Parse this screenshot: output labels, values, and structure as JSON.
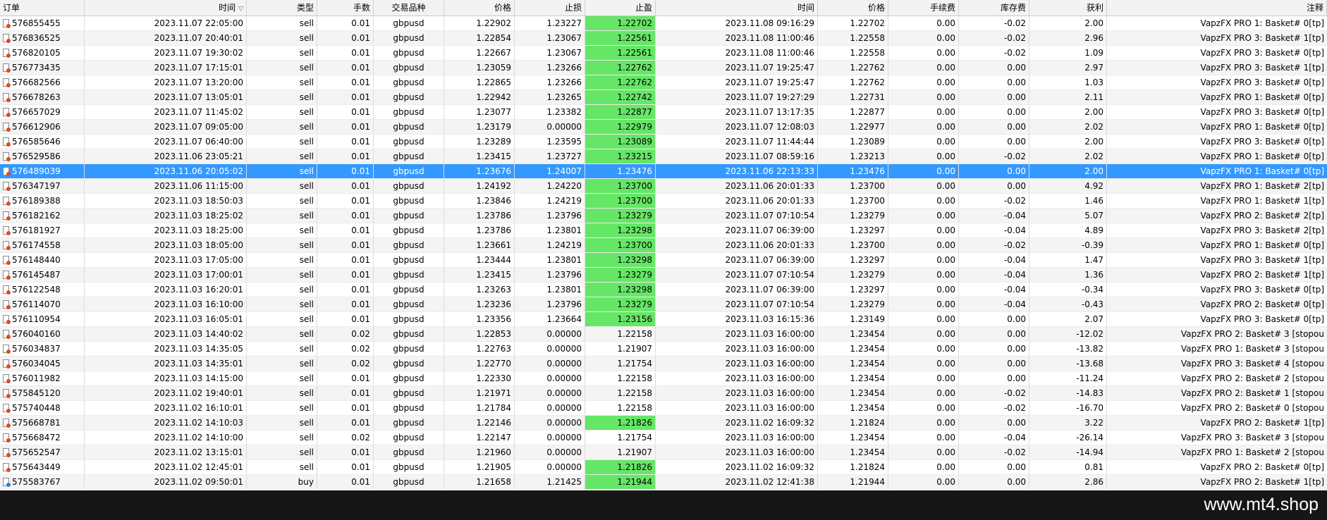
{
  "header": {
    "order": "订单",
    "time": "时间",
    "sort_indicator": "▽",
    "type": "类型",
    "lots": "手数",
    "symbol": "交易品种",
    "price": "价格",
    "sl": "止损",
    "tp": "止盈",
    "close_time": "时间",
    "close_price": "价格",
    "commission": "手续费",
    "swap": "库存费",
    "profit": "获利",
    "comment": "注释"
  },
  "rows": [
    [
      "576855455",
      "2023.11.07 22:05:00",
      "sell",
      "0.01",
      "gbpusd",
      "1.22902",
      "1.23227",
      "1.22702",
      "2023.11.08 09:16:29",
      "1.22702",
      "0.00",
      "-0.02",
      "2.00",
      "VapzFX PRO 1: Basket# 0[tp]"
    ],
    [
      "576836525",
      "2023.11.07 20:40:01",
      "sell",
      "0.01",
      "gbpusd",
      "1.22854",
      "1.23067",
      "1.22561",
      "2023.11.08 11:00:46",
      "1.22558",
      "0.00",
      "-0.02",
      "2.96",
      "VapzFX PRO 3: Basket# 1[tp]"
    ],
    [
      "576820105",
      "2023.11.07 19:30:02",
      "sell",
      "0.01",
      "gbpusd",
      "1.22667",
      "1.23067",
      "1.22561",
      "2023.11.08 11:00:46",
      "1.22558",
      "0.00",
      "-0.02",
      "1.09",
      "VapzFX PRO 3: Basket# 0[tp]"
    ],
    [
      "576773435",
      "2023.11.07 17:15:01",
      "sell",
      "0.01",
      "gbpusd",
      "1.23059",
      "1.23266",
      "1.22762",
      "2023.11.07 19:25:47",
      "1.22762",
      "0.00",
      "0.00",
      "2.97",
      "VapzFX PRO 3: Basket# 1[tp]"
    ],
    [
      "576682566",
      "2023.11.07 13:20:00",
      "sell",
      "0.01",
      "gbpusd",
      "1.22865",
      "1.23266",
      "1.22762",
      "2023.11.07 19:25:47",
      "1.22762",
      "0.00",
      "0.00",
      "1.03",
      "VapzFX PRO 3: Basket# 0[tp]"
    ],
    [
      "576678263",
      "2023.11.07 13:05:01",
      "sell",
      "0.01",
      "gbpusd",
      "1.22942",
      "1.23265",
      "1.22742",
      "2023.11.07 19:27:29",
      "1.22731",
      "0.00",
      "0.00",
      "2.11",
      "VapzFX PRO 1: Basket# 0[tp]"
    ],
    [
      "576657029",
      "2023.11.07 11:45:02",
      "sell",
      "0.01",
      "gbpusd",
      "1.23077",
      "1.23382",
      "1.22877",
      "2023.11.07 13:17:35",
      "1.22877",
      "0.00",
      "0.00",
      "2.00",
      "VapzFX PRO 3: Basket# 0[tp]"
    ],
    [
      "576612906",
      "2023.11.07 09:05:00",
      "sell",
      "0.01",
      "gbpusd",
      "1.23179",
      "0.00000",
      "1.22979",
      "2023.11.07 12:08:03",
      "1.22977",
      "0.00",
      "0.00",
      "2.02",
      "VapzFX PRO 1: Basket# 0[tp]"
    ],
    [
      "576585646",
      "2023.11.07 06:40:00",
      "sell",
      "0.01",
      "gbpusd",
      "1.23289",
      "1.23595",
      "1.23089",
      "2023.11.07 11:44:44",
      "1.23089",
      "0.00",
      "0.00",
      "2.00",
      "VapzFX PRO 3: Basket# 0[tp]"
    ],
    [
      "576529586",
      "2023.11.06 23:05:21",
      "sell",
      "0.01",
      "gbpusd",
      "1.23415",
      "1.23727",
      "1.23215",
      "2023.11.07 08:59:16",
      "1.23213",
      "0.00",
      "-0.02",
      "2.02",
      "VapzFX PRO 1: Basket# 0[tp]"
    ],
    [
      "576489039",
      "2023.11.06 20:05:02",
      "sell",
      "0.01",
      "gbpusd",
      "1.23676",
      "1.24007",
      "1.23476",
      "2023.11.06 22:13:33",
      "1.23476",
      "0.00",
      "0.00",
      "2.00",
      "VapzFX PRO 1: Basket# 0[tp]"
    ],
    [
      "576347197",
      "2023.11.06 11:15:00",
      "sell",
      "0.01",
      "gbpusd",
      "1.24192",
      "1.24220",
      "1.23700",
      "2023.11.06 20:01:33",
      "1.23700",
      "0.00",
      "0.00",
      "4.92",
      "VapzFX PRO 1: Basket# 2[tp]"
    ],
    [
      "576189388",
      "2023.11.03 18:50:03",
      "sell",
      "0.01",
      "gbpusd",
      "1.23846",
      "1.24219",
      "1.23700",
      "2023.11.06 20:01:33",
      "1.23700",
      "0.00",
      "-0.02",
      "1.46",
      "VapzFX PRO 1: Basket# 1[tp]"
    ],
    [
      "576182162",
      "2023.11.03 18:25:02",
      "sell",
      "0.01",
      "gbpusd",
      "1.23786",
      "1.23796",
      "1.23279",
      "2023.11.07 07:10:54",
      "1.23279",
      "0.00",
      "-0.04",
      "5.07",
      "VapzFX PRO 2: Basket# 2[tp]"
    ],
    [
      "576181927",
      "2023.11.03 18:25:00",
      "sell",
      "0.01",
      "gbpusd",
      "1.23786",
      "1.23801",
      "1.23298",
      "2023.11.07 06:39:00",
      "1.23297",
      "0.00",
      "-0.04",
      "4.89",
      "VapzFX PRO 3: Basket# 2[tp]"
    ],
    [
      "576174558",
      "2023.11.03 18:05:00",
      "sell",
      "0.01",
      "gbpusd",
      "1.23661",
      "1.24219",
      "1.23700",
      "2023.11.06 20:01:33",
      "1.23700",
      "0.00",
      "-0.02",
      "-0.39",
      "VapzFX PRO 1: Basket# 0[tp]"
    ],
    [
      "576148440",
      "2023.11.03 17:05:00",
      "sell",
      "0.01",
      "gbpusd",
      "1.23444",
      "1.23801",
      "1.23298",
      "2023.11.07 06:39:00",
      "1.23297",
      "0.00",
      "-0.04",
      "1.47",
      "VapzFX PRO 3: Basket# 1[tp]"
    ],
    [
      "576145487",
      "2023.11.03 17:00:01",
      "sell",
      "0.01",
      "gbpusd",
      "1.23415",
      "1.23796",
      "1.23279",
      "2023.11.07 07:10:54",
      "1.23279",
      "0.00",
      "-0.04",
      "1.36",
      "VapzFX PRO 2: Basket# 1[tp]"
    ],
    [
      "576122548",
      "2023.11.03 16:20:01",
      "sell",
      "0.01",
      "gbpusd",
      "1.23263",
      "1.23801",
      "1.23298",
      "2023.11.07 06:39:00",
      "1.23297",
      "0.00",
      "-0.04",
      "-0.34",
      "VapzFX PRO 3: Basket# 0[tp]"
    ],
    [
      "576114070",
      "2023.11.03 16:10:00",
      "sell",
      "0.01",
      "gbpusd",
      "1.23236",
      "1.23796",
      "1.23279",
      "2023.11.07 07:10:54",
      "1.23279",
      "0.00",
      "-0.04",
      "-0.43",
      "VapzFX PRO 2: Basket# 0[tp]"
    ],
    [
      "576110954",
      "2023.11.03 16:05:01",
      "sell",
      "0.01",
      "gbpusd",
      "1.23356",
      "1.23664",
      "1.23156",
      "2023.11.03 16:15:36",
      "1.23149",
      "0.00",
      "0.00",
      "2.07",
      "VapzFX PRO 3: Basket# 0[tp]"
    ],
    [
      "576040160",
      "2023.11.03 14:40:02",
      "sell",
      "0.02",
      "gbpusd",
      "1.22853",
      "0.00000",
      "1.22158",
      "2023.11.03 16:00:00",
      "1.23454",
      "0.00",
      "0.00",
      "-12.02",
      "VapzFX PRO 2: Basket# 3 [stopou"
    ],
    [
      "576034837",
      "2023.11.03 14:35:05",
      "sell",
      "0.02",
      "gbpusd",
      "1.22763",
      "0.00000",
      "1.21907",
      "2023.11.03 16:00:00",
      "1.23454",
      "0.00",
      "0.00",
      "-13.82",
      "VapzFX PRO 1: Basket# 3 [stopou"
    ],
    [
      "576034045",
      "2023.11.03 14:35:01",
      "sell",
      "0.02",
      "gbpusd",
      "1.22770",
      "0.00000",
      "1.21754",
      "2023.11.03 16:00:00",
      "1.23454",
      "0.00",
      "0.00",
      "-13.68",
      "VapzFX PRO 3: Basket# 4 [stopou"
    ],
    [
      "576011982",
      "2023.11.03 14:15:00",
      "sell",
      "0.01",
      "gbpusd",
      "1.22330",
      "0.00000",
      "1.22158",
      "2023.11.03 16:00:00",
      "1.23454",
      "0.00",
      "0.00",
      "-11.24",
      "VapzFX PRO 2: Basket# 2 [stopou"
    ],
    [
      "575845120",
      "2023.11.02 19:40:01",
      "sell",
      "0.01",
      "gbpusd",
      "1.21971",
      "0.00000",
      "1.22158",
      "2023.11.03 16:00:00",
      "1.23454",
      "0.00",
      "-0.02",
      "-14.83",
      "VapzFX PRO 2: Basket# 1 [stopou"
    ],
    [
      "575740448",
      "2023.11.02 16:10:01",
      "sell",
      "0.01",
      "gbpusd",
      "1.21784",
      "0.00000",
      "1.22158",
      "2023.11.03 16:00:00",
      "1.23454",
      "0.00",
      "-0.02",
      "-16.70",
      "VapzFX PRO 2: Basket# 0 [stopou"
    ],
    [
      "575668781",
      "2023.11.02 14:10:03",
      "sell",
      "0.01",
      "gbpusd",
      "1.22146",
      "0.00000",
      "1.21826",
      "2023.11.02 16:09:32",
      "1.21824",
      "0.00",
      "0.00",
      "3.22",
      "VapzFX PRO 2: Basket# 1[tp]"
    ],
    [
      "575668472",
      "2023.11.02 14:10:00",
      "sell",
      "0.02",
      "gbpusd",
      "1.22147",
      "0.00000",
      "1.21754",
      "2023.11.03 16:00:00",
      "1.23454",
      "0.00",
      "-0.04",
      "-26.14",
      "VapzFX PRO 3: Basket# 3 [stopou"
    ],
    [
      "575652547",
      "2023.11.02 13:15:01",
      "sell",
      "0.01",
      "gbpusd",
      "1.21960",
      "0.00000",
      "1.21907",
      "2023.11.03 16:00:00",
      "1.23454",
      "0.00",
      "-0.02",
      "-14.94",
      "VapzFX PRO 1: Basket# 2 [stopou"
    ],
    [
      "575643449",
      "2023.11.02 12:45:01",
      "sell",
      "0.01",
      "gbpusd",
      "1.21905",
      "0.00000",
      "1.21826",
      "2023.11.02 16:09:32",
      "1.21824",
      "0.00",
      "0.00",
      "0.81",
      "VapzFX PRO 2: Basket# 0[tp]"
    ],
    [
      "575583767",
      "2023.11.02 09:50:01",
      "buy",
      "0.01",
      "gbpusd",
      "1.21658",
      "1.21425",
      "1.21944",
      "2023.11.02 12:41:38",
      "1.21944",
      "0.00",
      "0.00",
      "2.86",
      "VapzFX PRO 2: Basket# 1[tp]"
    ]
  ],
  "tp_hit_rows": [
    0,
    1,
    2,
    3,
    4,
    5,
    6,
    7,
    8,
    9,
    10,
    11,
    12,
    13,
    14,
    15,
    16,
    17,
    18,
    19,
    20,
    27,
    30,
    31
  ],
  "selected_row": 10,
  "colors": {
    "tp_hit": "#66e666",
    "selected": "#3399ff",
    "footer_bg": "#161616"
  },
  "footer": {
    "watermark": "www.mt4.shop"
  }
}
